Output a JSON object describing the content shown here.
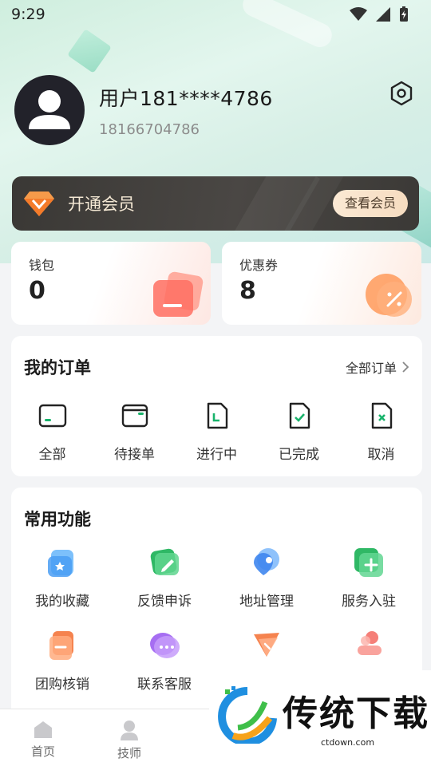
{
  "status": {
    "time": "9:29"
  },
  "profile": {
    "username": "用户181****4786",
    "phone": "18166704786"
  },
  "vip": {
    "label": "开通会员",
    "button": "查看会员"
  },
  "stats": {
    "wallet": {
      "label": "钱包",
      "value": "0"
    },
    "coupon": {
      "label": "优惠券",
      "value": "8"
    }
  },
  "orders": {
    "title": "我的订单",
    "all_label": "全部订单",
    "items": [
      {
        "label": "全部",
        "icon": "card-icon"
      },
      {
        "label": "待接单",
        "icon": "wallet-icon"
      },
      {
        "label": "进行中",
        "icon": "doc-progress-icon"
      },
      {
        "label": "已完成",
        "icon": "doc-check-icon"
      },
      {
        "label": "取消",
        "icon": "doc-cancel-icon"
      }
    ]
  },
  "functions": {
    "title": "常用功能",
    "items": [
      {
        "label": "我的收藏",
        "icon": "favorites-icon",
        "color": "#5aa8f5"
      },
      {
        "label": "反馈申诉",
        "icon": "feedback-icon",
        "color": "#3fc476"
      },
      {
        "label": "地址管理",
        "icon": "location-icon",
        "color": "#4a8ef0"
      },
      {
        "label": "服务入驻",
        "icon": "join-icon",
        "color": "#3fc476"
      },
      {
        "label": "团购核销",
        "icon": "groupbuy-icon",
        "color": "#f5834f"
      },
      {
        "label": "联系客服",
        "icon": "chat-icon",
        "color": "#a66ef2"
      },
      {
        "label": "",
        "icon": "share-icon",
        "color": "#f5834f"
      },
      {
        "label": "",
        "icon": "users-icon",
        "color": "#f57f78"
      }
    ]
  },
  "tabbar": [
    {
      "label": "首页",
      "icon": "home-icon"
    },
    {
      "label": "技师",
      "icon": "technician-icon"
    }
  ],
  "watermark": {
    "text": "传统下载",
    "url": "ctdown.com"
  }
}
